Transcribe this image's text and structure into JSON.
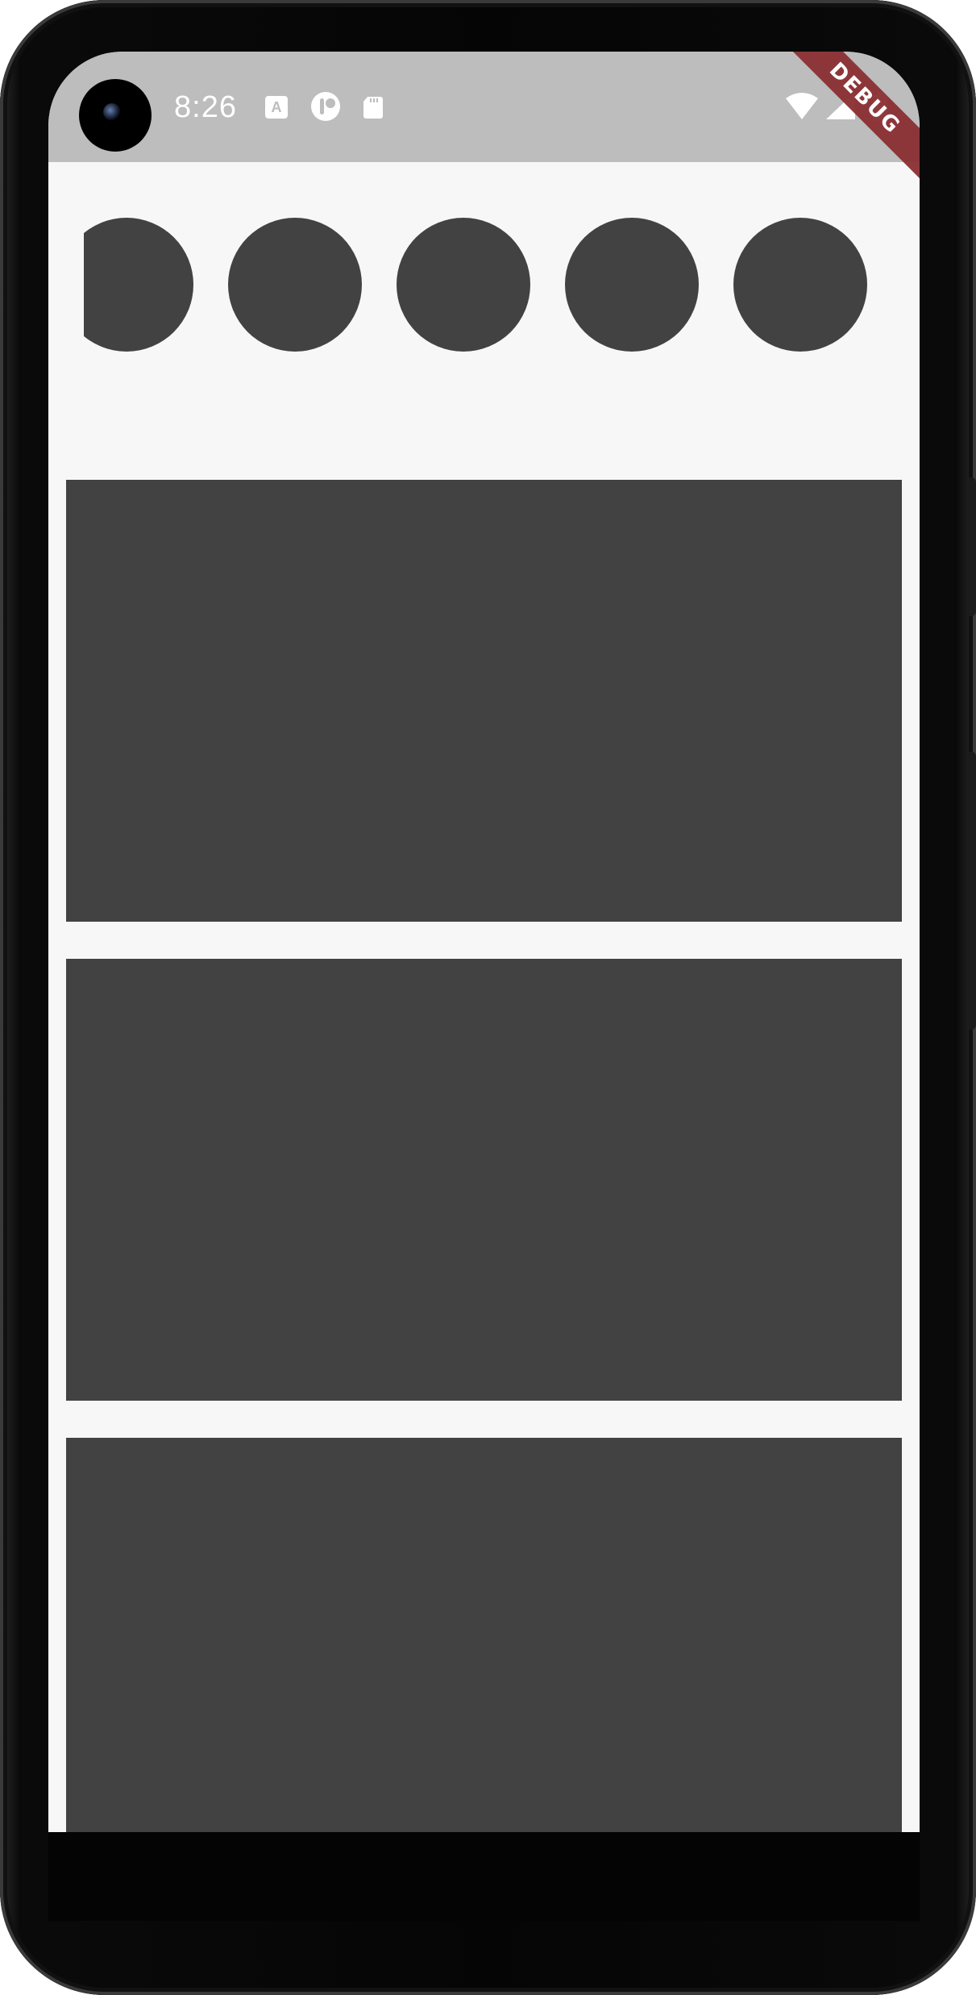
{
  "status_bar": {
    "time": "8:26",
    "background": "#bdbdbd",
    "left_icons": [
      "text-a-icon",
      "circle-app-icon",
      "sd-card-icon"
    ],
    "right_icons": [
      "wifi-icon",
      "signal-icon",
      "battery-icon"
    ]
  },
  "debug_banner": {
    "label": "DEBUG",
    "color": "#8b2f33"
  },
  "content": {
    "background": "#f7f7f7",
    "placeholder_color": "#424242",
    "story_circles": 5,
    "cards": 3
  }
}
